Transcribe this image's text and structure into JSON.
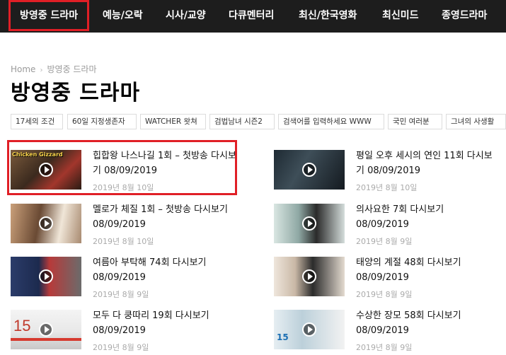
{
  "nav": {
    "items": [
      "방영중 드라마",
      "예능/오락",
      "시사/교양",
      "다큐멘터리",
      "최신/한국영화",
      "최신미드",
      "종영드라마"
    ],
    "active_index": 0
  },
  "breadcrumb": {
    "home": "Home",
    "current": "방영중 드라마"
  },
  "page_title": "방영중 드라마",
  "tags": [
    "17세의 조건",
    "60일 지정생존자",
    "WATCHER 왓쳐",
    "검법남녀 시즌2",
    "검색어를 입력하세요 WWW",
    "국민 여러분",
    "그녀의 사생활"
  ],
  "posts": [
    {
      "title": "힙합왕 나스나길 1회 – 첫방송 다시보기 08/09/2019",
      "date": "2019년 8월 10일",
      "thumb_text": "Chicken Gizzard"
    },
    {
      "title": "평일 오후 세시의 연인 11회 다시보기 08/09/2019",
      "date": "2019년 8월 10일"
    },
    {
      "title": "멜로가 체질 1회 – 첫방송 다시보기 08/09/2019",
      "date": "2019년 8월 10일"
    },
    {
      "title": "의사요한 7회 다시보기 08/09/2019",
      "date": "2019년 8월 9일"
    },
    {
      "title": "여름아 부탁해 74회 다시보기 08/09/2019",
      "date": "2019년 8월 9일"
    },
    {
      "title": "태양의 계절 48회 다시보기 08/09/2019",
      "date": "2019년 8월 9일"
    },
    {
      "title": "모두 다 쿵따리 19회 다시보기 08/09/2019",
      "date": "2019년 8월 9일",
      "thumb_text": "15"
    },
    {
      "title": "수상한 장모 58회 다시보기 08/09/2019",
      "date": "2019년 8월 9일",
      "thumb_text": "15"
    }
  ],
  "colors": {
    "nav_bg": "#1d1d1d",
    "highlight": "#e01f26",
    "muted": "#aaaaaa"
  }
}
